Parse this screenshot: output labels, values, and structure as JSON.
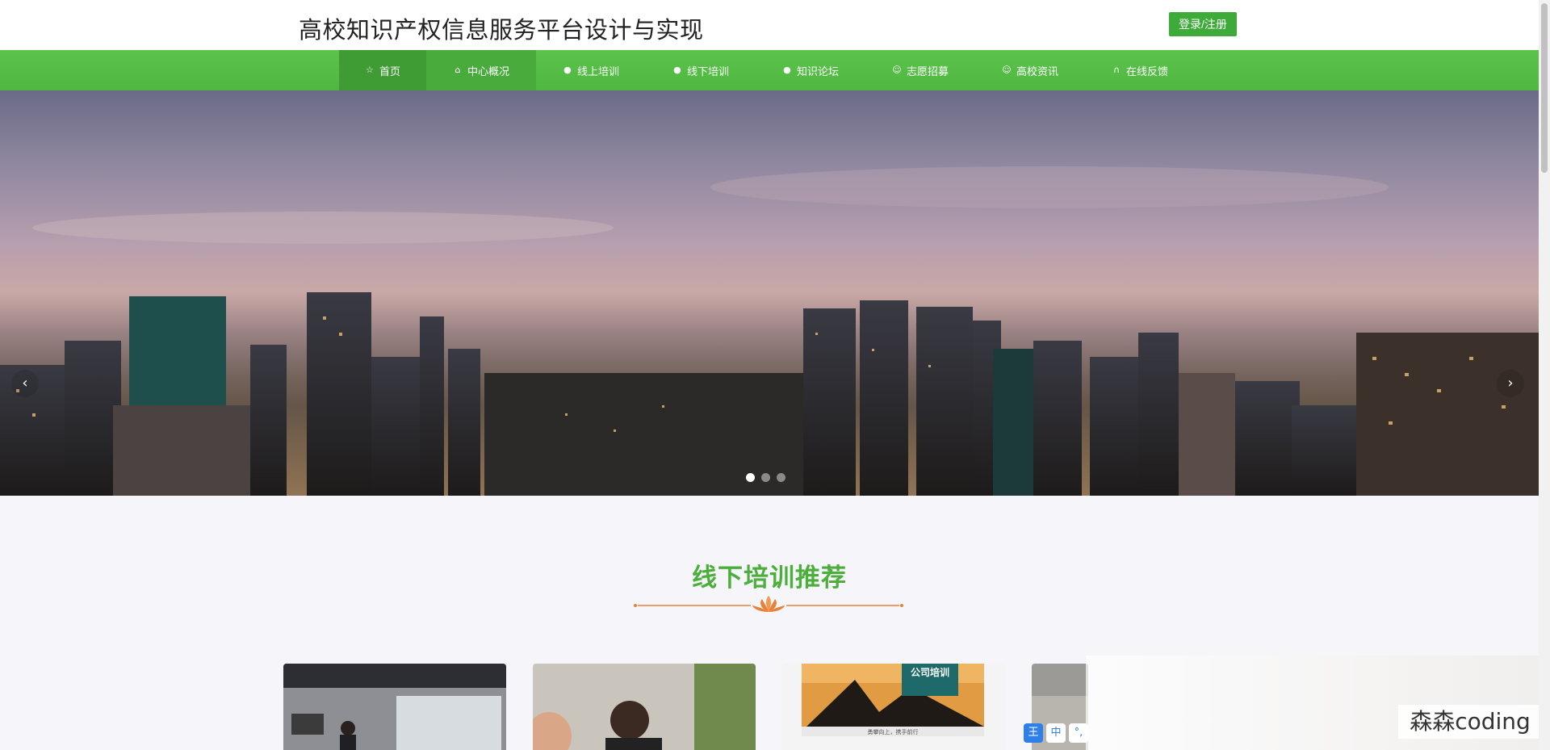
{
  "header": {
    "site_title": "高校知识产权信息服务平台设计与实现",
    "login_label": "登录/注册"
  },
  "nav": {
    "items": [
      {
        "label": "首页",
        "icon": "star-icon",
        "active": true
      },
      {
        "label": "中心概况",
        "icon": "home-icon",
        "active": false
      },
      {
        "label": "线上培训",
        "icon": "info-icon",
        "active": false
      },
      {
        "label": "线下培训",
        "icon": "info-icon",
        "active": false
      },
      {
        "label": "知识论坛",
        "icon": "info-icon",
        "active": false
      },
      {
        "label": "志愿招募",
        "icon": "smile-icon",
        "active": false
      },
      {
        "label": "高校资讯",
        "icon": "smile-icon",
        "active": false
      },
      {
        "label": "在线反馈",
        "icon": "headset-icon",
        "active": false
      }
    ]
  },
  "banner": {
    "prev_label": "‹",
    "next_label": "›",
    "slide_count": 3,
    "active_slide": 0
  },
  "section": {
    "title": "线下培训推荐"
  },
  "cards": [
    {
      "caption": ""
    },
    {
      "caption": ""
    },
    {
      "caption": "公司培训",
      "subcaption": "勇攀向上，携手前行"
    },
    {
      "caption": ""
    }
  ],
  "overlay": {
    "watermark": "森森coding",
    "ime_primary": "王",
    "ime_lang": "中",
    "ime_punct": "°,"
  },
  "colors": {
    "brand_green": "#4fb741",
    "title_green": "#4caf3b",
    "ornament_orange": "#e8803a"
  }
}
